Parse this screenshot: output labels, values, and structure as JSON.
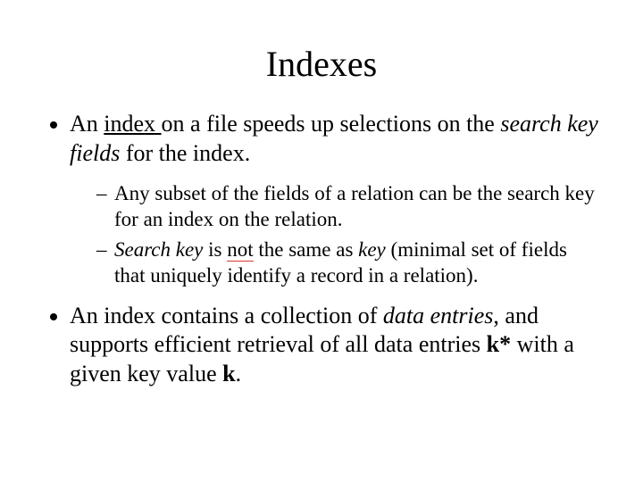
{
  "title": "Indexes",
  "bullets": {
    "b1": {
      "t1": "An ",
      "index": "index ",
      "t2": "on a file speeds up selections on the ",
      "skf": "search key fields",
      "t3": " for the index."
    },
    "sub": {
      "s1": "Any subset of the fields of a relation can be the search key for an index on the relation.",
      "s2": {
        "sk": "Search key",
        "t1": " is ",
        "not": "not",
        "t2": " the same as ",
        "key": "key",
        "t3": " (minimal set of fields that uniquely identify a record in a relation)."
      }
    },
    "b2": {
      "t1": "An index contains a collection of ",
      "de": "data entries",
      "t2": ", and supports efficient retrieval of all data entries ",
      "kstar": "k*",
      "t3": " with a given key value ",
      "k": "k",
      "t4": "."
    }
  }
}
